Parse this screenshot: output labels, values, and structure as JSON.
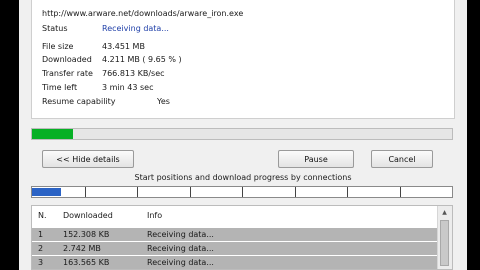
{
  "download": {
    "url": "http://www.arware.net/downloads/arware_iron.exe",
    "status": {
      "label": "Status",
      "value": "Receiving data..."
    },
    "file_size": {
      "label": "File size",
      "value": "43.451  MB"
    },
    "downloaded": {
      "label": "Downloaded",
      "value": "4.211  MB  ( 9.65 % )"
    },
    "transfer_rate": {
      "label": "Transfer rate",
      "value": "766.813  KB/sec"
    },
    "time_left": {
      "label": "Time left",
      "value": "3 min 43 sec"
    },
    "resume": {
      "label": "Resume capability",
      "value": "Yes"
    },
    "progress_fraction": 0.0965
  },
  "buttons": {
    "hide_details": "<< Hide details",
    "pause": "Pause",
    "cancel": "Cancel"
  },
  "connections": {
    "caption": "Start positions and download progress by connections",
    "bar": {
      "segments": [
        {
          "start": 0.0,
          "end": 0.07
        }
      ],
      "ticks": [
        0.125,
        0.25,
        0.375,
        0.5,
        0.625,
        0.75,
        0.875
      ]
    },
    "columns": [
      "N.",
      "Downloaded",
      "Info"
    ],
    "rows": [
      {
        "n": "1",
        "downloaded": "152.308  KB",
        "info": "Receiving data..."
      },
      {
        "n": "2",
        "downloaded": "2.742  MB",
        "info": "Receiving data..."
      },
      {
        "n": "3",
        "downloaded": "163.565  KB",
        "info": "Receiving data..."
      }
    ]
  },
  "scrollbar": {
    "up_icon": "scroll-up-arrow"
  },
  "colors": {
    "progress": "#06b025",
    "connection_segment": "#2b63c5",
    "status_value": "#1f3fa8",
    "row_highlight": "#b4b4b4"
  }
}
